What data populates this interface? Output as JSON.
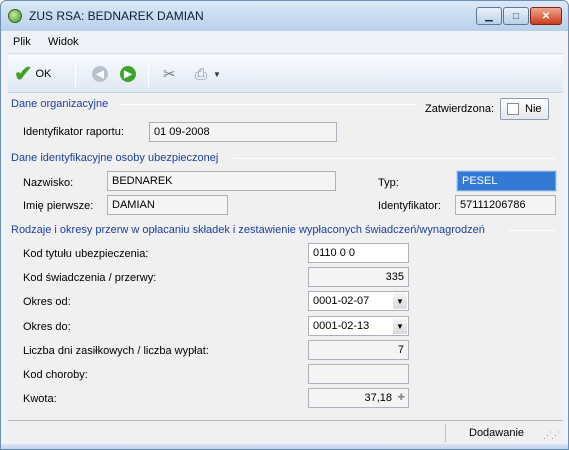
{
  "window": {
    "title": "ZUS RSA: BEDNAREK DAMIAN"
  },
  "menu": {
    "items": [
      "Plik",
      "Widok"
    ]
  },
  "toolbar": {
    "ok_label": "OK"
  },
  "sections": {
    "org": "Dane organizacyjne",
    "person": "Dane identyfikacyjne osoby ubezpieczonej",
    "breaks": "Rodzaje i okresy przerw w opłacaniu składek i zestawienie wypłaconych świadczeń/wynagrodzeń"
  },
  "org": {
    "approved_label": "Zatwierdzona:",
    "approved_value": "Nie",
    "report_id_label": "Identyfikator raportu:",
    "report_id_value": "01 09-2008"
  },
  "person": {
    "surname_label": "Nazwisko:",
    "surname_value": "BEDNAREK",
    "firstname_label": "Imię pierwsze:",
    "firstname_value": "DAMIAN",
    "type_label": "Typ:",
    "type_value": "PESEL",
    "identifier_label": "Identyfikator:",
    "identifier_value": "57111206786"
  },
  "form": {
    "insurance_code_label": "Kod tytułu ubezpieczenia:",
    "insurance_code_value": "0110 0 0",
    "benefit_code_label": "Kod świadczenia / przerwy:",
    "benefit_code_value": "335",
    "period_from_label": "Okres od:",
    "period_from_value": "0001-02-07",
    "period_to_label": "Okres do:",
    "period_to_value": "0001-02-13",
    "days_label": "Liczba dni zasiłkowych / liczba wypłat:",
    "days_value": "7",
    "disease_code_label": "Kod choroby:",
    "disease_code_value": "",
    "amount_label": "Kwota:",
    "amount_value": "37,18"
  },
  "status": {
    "mode": "Dodawanie"
  }
}
